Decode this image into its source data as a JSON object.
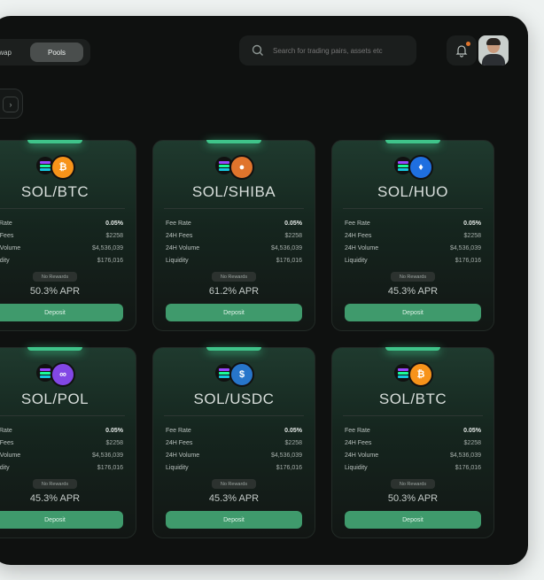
{
  "header": {
    "tabs": [
      "Swap",
      "Pools"
    ],
    "active_tab": "Pools",
    "search_placeholder": "Search for trading pairs, assets etc"
  },
  "labels": {
    "fee_rate": "Fee Rate",
    "fees_24h": "24H Fees",
    "volume_24h": "24H Volume",
    "liquidity": "Liquidity",
    "badge": "No Rewards",
    "deposit": "Deposit"
  },
  "cards": [
    {
      "pair": "SOL/BTC",
      "token": "BTC",
      "fee_rate": "0.05%",
      "fees": "$2258",
      "volume": "$4,536,039",
      "liquidity": "$176,016",
      "apr": "50.3% APR"
    },
    {
      "pair": "SOL/SHIBA",
      "token": "SHIBA",
      "fee_rate": "0.05%",
      "fees": "$2258",
      "volume": "$4,536,039",
      "liquidity": "$176,016",
      "apr": "61.2% APR"
    },
    {
      "pair": "SOL/HUO",
      "token": "HUO",
      "fee_rate": "0.05%",
      "fees": "$2258",
      "volume": "$4,536,039",
      "liquidity": "$176,016",
      "apr": "45.3% APR"
    },
    {
      "pair": "SOL/POL",
      "token": "POL",
      "fee_rate": "0.05%",
      "fees": "$2258",
      "volume": "$4,536,039",
      "liquidity": "$176,016",
      "apr": "45.3% APR"
    },
    {
      "pair": "SOL/USDC",
      "token": "USDC",
      "fee_rate": "0.05%",
      "fees": "$2258",
      "volume": "$4,536,039",
      "liquidity": "$176,016",
      "apr": "45.3% APR"
    },
    {
      "pair": "SOL/BTC",
      "token": "BTC",
      "fee_rate": "0.05%",
      "fees": "$2258",
      "volume": "$4,536,039",
      "liquidity": "$176,016",
      "apr": "50.3% APR"
    }
  ],
  "colors": {
    "accent": "#3f9a6c",
    "glow": "#3fc48a",
    "btc": "#f7931a",
    "shiba": "#e0742c",
    "huo": "#1f6fe0",
    "pol": "#8247e5",
    "usdc": "#2775ca"
  }
}
